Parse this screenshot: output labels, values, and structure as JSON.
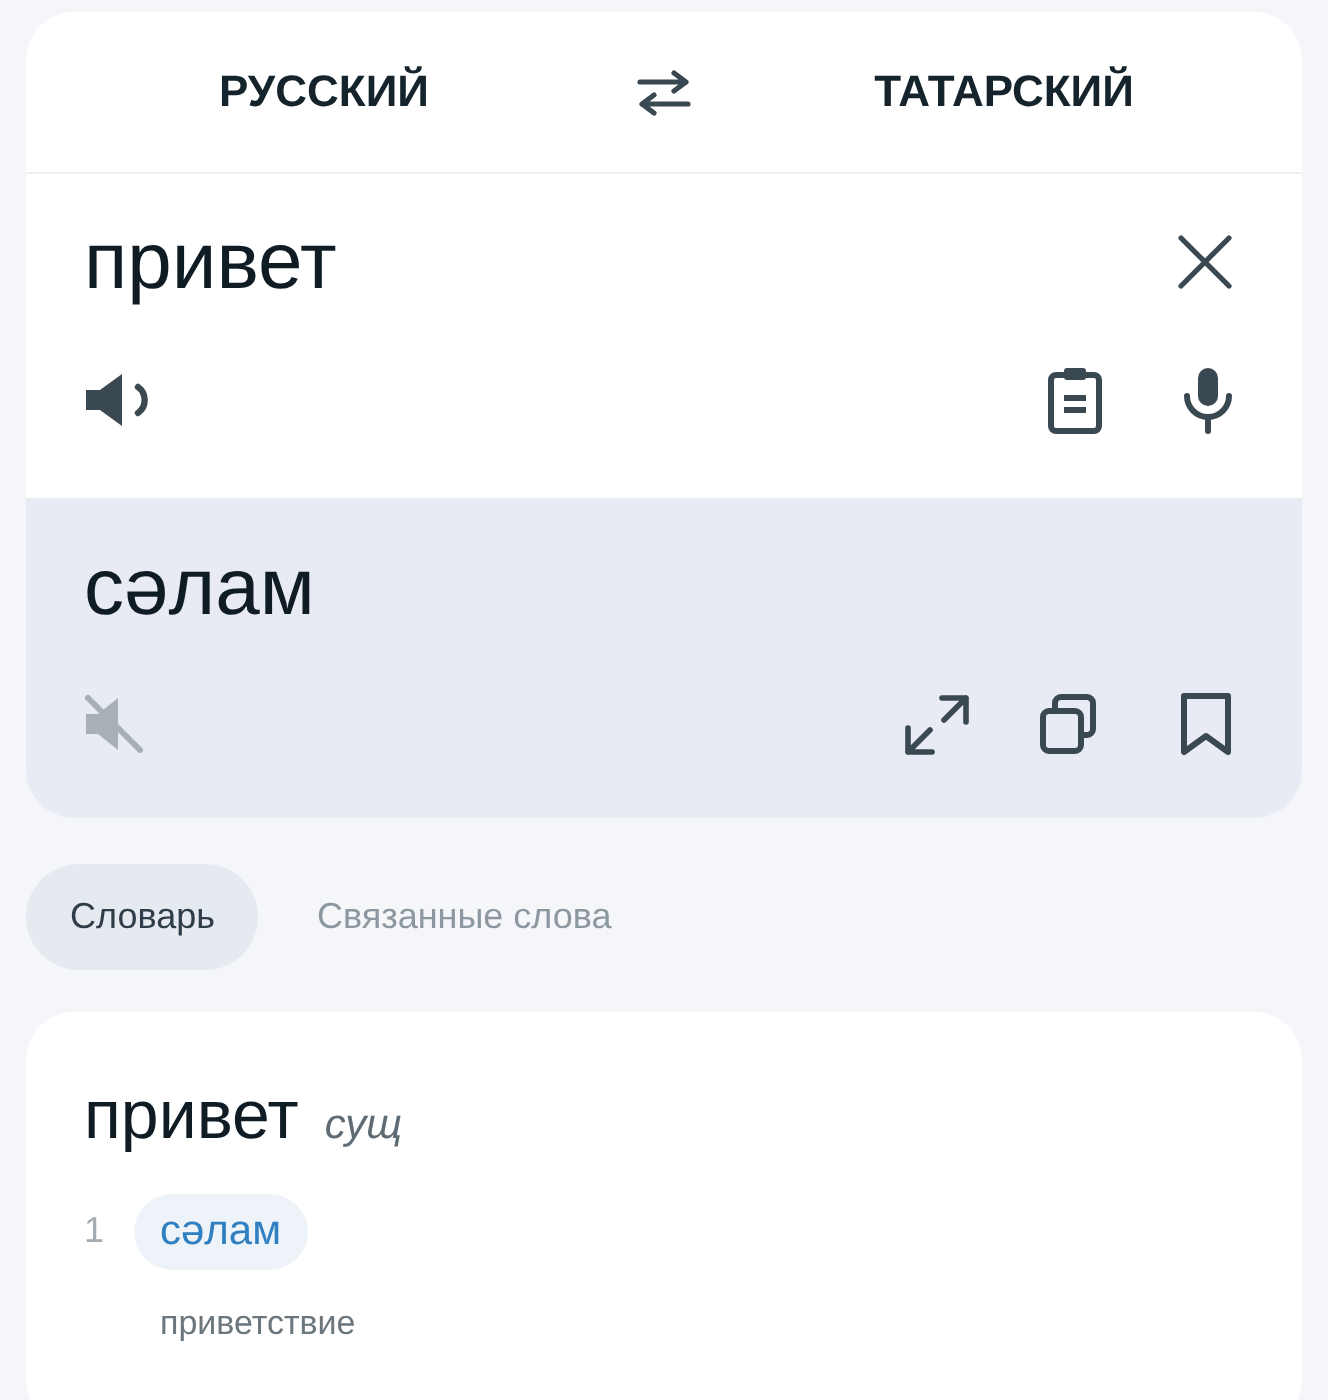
{
  "languages": {
    "source": "РУССКИЙ",
    "target": "ТАТАРСКИЙ"
  },
  "input": {
    "value": "привет",
    "speech_enabled": true
  },
  "output": {
    "text": "сәлам",
    "speech_enabled": false
  },
  "tabs": [
    {
      "label": "Словарь",
      "selected": true
    },
    {
      "label": "Связанные слова",
      "selected": false
    }
  ],
  "dictionary": {
    "entries": [
      {
        "word": "привет",
        "part_of_speech": "сущ",
        "senses": [
          {
            "number": "1",
            "translations": [
              "сәлам"
            ],
            "gloss": "приветствие"
          }
        ]
      }
    ]
  }
}
